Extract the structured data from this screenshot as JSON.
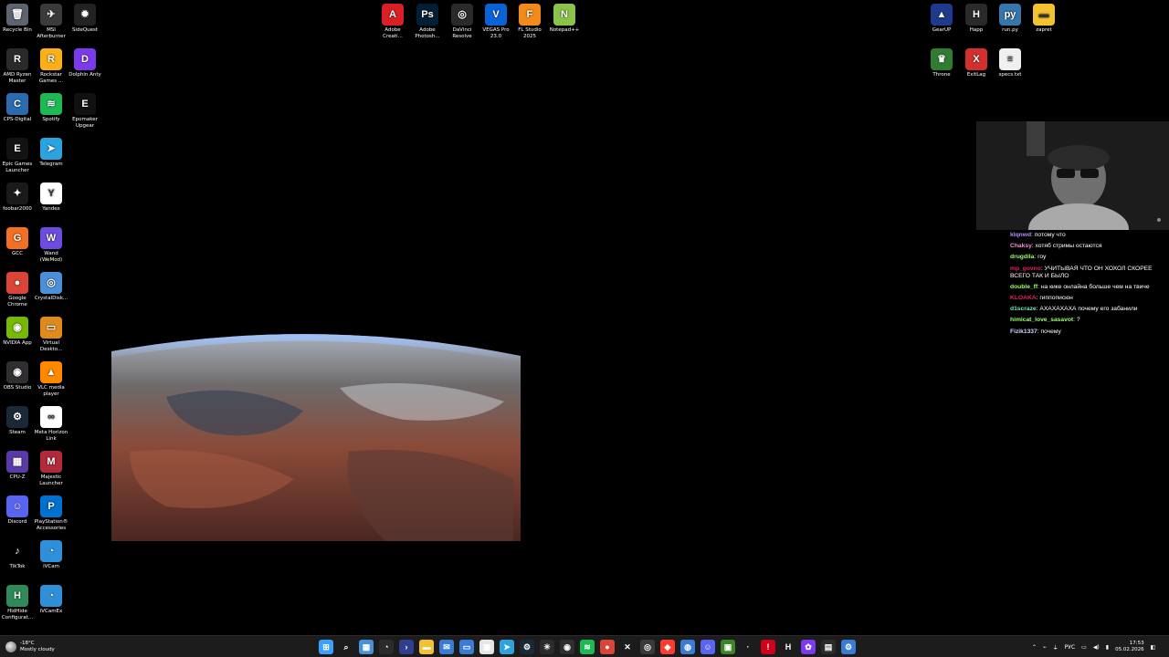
{
  "desktop_icons": [
    {
      "label": "Recycle Bin",
      "icon": "recycle-bin-icon",
      "color": "#5b6470"
    },
    {
      "label": "MSI Afterburner",
      "icon": "msi-afterburner-icon",
      "color": "#3a3a3a"
    },
    {
      "label": "SideQuest",
      "icon": "sidequest-icon",
      "color": "#222222"
    },
    {
      "label": "AMD Ryzen Master",
      "icon": "amd-ryzen-master-icon",
      "color": "#2a2a2a"
    },
    {
      "label": "Rockstar Games ...",
      "icon": "rockstar-games-icon",
      "color": "#fcaf17"
    },
    {
      "label": "Dolphin Anty",
      "icon": "dolphin-anty-icon",
      "color": "#7c3aed"
    },
    {
      "label": "CPS-Digital",
      "icon": "cps-digital-icon",
      "color": "#2b6cb0"
    },
    {
      "label": "Spotify",
      "icon": "spotify-icon",
      "color": "#1db954"
    },
    {
      "label": "Epomaker Upgear",
      "icon": "epomaker-icon",
      "color": "#111111"
    },
    {
      "label": "Epic Games Launcher",
      "icon": "epic-games-icon",
      "color": "#121212"
    },
    {
      "label": "Telegram",
      "icon": "telegram-icon",
      "color": "#2aa3df"
    },
    {
      "label": "foobar2000",
      "icon": "foobar2000-icon",
      "color": "#1a1a1a"
    },
    {
      "label": "Yandex",
      "icon": "yandex-icon",
      "color": "#ffffff"
    },
    {
      "label": "GCC",
      "icon": "gcc-icon",
      "color": "#f36f21"
    },
    {
      "label": "Wand (WeMod)",
      "icon": "wand-icon",
      "color": "#6f4ce0"
    },
    {
      "label": "Google Chrome",
      "icon": "chrome-icon",
      "color": "#db4437"
    },
    {
      "label": "CrystalDisk...",
      "icon": "crystaldisk-icon",
      "color": "#4a90d9"
    },
    {
      "label": "NVIDIA App",
      "icon": "nvidia-icon",
      "color": "#76b900"
    },
    {
      "label": "Virtual Deskto...",
      "icon": "virtual-desktop-icon",
      "color": "#e08a1e"
    },
    {
      "label": "OBS Studio",
      "icon": "obs-icon",
      "color": "#302e31"
    },
    {
      "label": "VLC media player",
      "icon": "vlc-icon",
      "color": "#ff8800"
    },
    {
      "label": "Steam",
      "icon": "steam-icon",
      "color": "#1b2838"
    },
    {
      "label": "Meta Horizon Link",
      "icon": "meta-icon",
      "color": "#ffffff"
    },
    {
      "label": "CPU-Z",
      "icon": "cpu-z-icon",
      "color": "#5a3aa8"
    },
    {
      "label": "Majestic Launcher",
      "icon": "majestic-icon",
      "color": "#b02a3a"
    },
    {
      "label": "Discord",
      "icon": "discord-icon",
      "color": "#5865f2"
    },
    {
      "label": "PlayStation® Accessories",
      "icon": "playstation-icon",
      "color": "#0070d1"
    },
    {
      "label": "TikTok",
      "icon": "tiktok-icon",
      "color": "#000000"
    },
    {
      "label": "iVCam",
      "icon": "ivcam-icon",
      "color": "#2f8fd8"
    },
    {
      "label": "HidHide Configurat...",
      "icon": "hidhide-icon",
      "color": "#2e8b57"
    },
    {
      "label": "iVCamEx",
      "icon": "ivcamex-icon",
      "color": "#2f8fd8"
    },
    {
      "label": "Adobe Creati...",
      "icon": "adobe-cc-icon",
      "color": "#da1f26"
    },
    {
      "label": "Adobe Photosh...",
      "icon": "photoshop-icon",
      "color": "#001e36"
    },
    {
      "label": "DaVinci Resolve",
      "icon": "davinci-icon",
      "color": "#2a2a2a"
    },
    {
      "label": "VEGAS Pro 23.0",
      "icon": "vegas-icon",
      "color": "#0a63d6"
    },
    {
      "label": "FL Studio 2025",
      "icon": "fl-studio-icon",
      "color": "#f28b1b"
    },
    {
      "label": "Notepad++",
      "icon": "notepadpp-icon",
      "color": "#8bc34a"
    },
    {
      "label": "GearUP",
      "icon": "gearup-icon",
      "color": "#1e3a8a"
    },
    {
      "label": "Happ",
      "icon": "happ-icon",
      "color": "#2a2a2a"
    },
    {
      "label": "run.py",
      "icon": "python-file-icon",
      "color": "#3776ab"
    },
    {
      "label": "zapret",
      "icon": "folder-icon",
      "color": "#f3c230"
    },
    {
      "label": "Throne",
      "icon": "throne-icon",
      "color": "#2e7d32"
    },
    {
      "label": "ExitLag",
      "icon": "exitlag-icon",
      "color": "#d32f2f"
    },
    {
      "label": "specs.txt",
      "icon": "text-file-icon",
      "color": "#f0f0f0"
    }
  ],
  "chat": {
    "messages": [
      {
        "nick": "klqnwd",
        "nick_color": "#b58cff",
        "text": "потому что"
      },
      {
        "nick": "Chaksy",
        "nick_color": "#ff8ad8",
        "text": "хотяб стримы остаются"
      },
      {
        "nick": "drugdila",
        "nick_color": "#9dff6e",
        "text": "гоу"
      },
      {
        "nick": "mp_govno",
        "nick_color": "#e0245e",
        "text": "УЧИТЫВАЯ ЧТО ОН ХОХОЛ СКОРЕЕ ВСЕГО ТАК И БЫЛО"
      },
      {
        "nick": "double_ff",
        "nick_color": "#9dff6e",
        "text": "на кике онлайна больше чем на твиче"
      },
      {
        "nick": "KLOAKA",
        "nick_color": "#e0245e",
        "text": "гиппописюн"
      },
      {
        "nick": "d1scraze",
        "nick_color": "#6ee7b7",
        "text": "АХАХАХАХА почему его забанили"
      },
      {
        "nick": "himicat_love_sasavot",
        "nick_color": "#9dff6e",
        "text": "?"
      },
      {
        "nick": "Fizik1337",
        "nick_color": "#cfd8ff",
        "text": "почему"
      }
    ]
  },
  "taskbar": {
    "weather_temp": "-18°C",
    "weather_desc": "Mostly cloudy",
    "pinned": [
      {
        "icon": "start-icon",
        "color": "#3aa0ff",
        "glyph": "⊞"
      },
      {
        "icon": "search-icon",
        "color": "#1c1c1c",
        "glyph": "⌕"
      },
      {
        "icon": "widgets-icon",
        "color": "#4a90d9",
        "glyph": "▦"
      },
      {
        "icon": "copilot-icon",
        "color": "#2b2b2b",
        "glyph": "◔"
      },
      {
        "icon": "terminal-icon",
        "color": "#2f3e8f",
        "glyph": "›"
      },
      {
        "icon": "file-explorer-icon",
        "color": "#f3c230",
        "glyph": "▬"
      },
      {
        "icon": "mail-icon",
        "color": "#3a7bd5",
        "glyph": "✉"
      },
      {
        "icon": "photos-icon",
        "color": "#3a7bd5",
        "glyph": "▭"
      },
      {
        "icon": "store-icon",
        "color": "#e5e5e5",
        "glyph": "▣"
      },
      {
        "icon": "telegram-icon",
        "color": "#2aa3df",
        "glyph": "➤"
      },
      {
        "icon": "steam-icon",
        "color": "#1b2838",
        "glyph": "⚙"
      },
      {
        "icon": "chatgpt-icon",
        "color": "#2b2b2b",
        "glyph": "✳"
      },
      {
        "icon": "obs-icon",
        "color": "#302e31",
        "glyph": "◉"
      },
      {
        "icon": "spotify-icon",
        "color": "#1db954",
        "glyph": "≋"
      },
      {
        "icon": "chrome-icon",
        "color": "#db4437",
        "glyph": "●"
      },
      {
        "icon": "capcut-icon",
        "color": "#1c1c1c",
        "glyph": "✕"
      },
      {
        "icon": "davinci-icon",
        "color": "#3a3a3a",
        "glyph": "◎"
      },
      {
        "icon": "yandex-browser-icon",
        "color": "#ff3b30",
        "glyph": "◆"
      },
      {
        "icon": "vpn-icon",
        "color": "#3a7bd5",
        "glyph": "◍"
      },
      {
        "icon": "discord-icon",
        "color": "#5865f2",
        "glyph": "☺"
      },
      {
        "icon": "minecraft-icon",
        "color": "#3c8527",
        "glyph": "▣"
      },
      {
        "icon": "app-icon",
        "color": "#1c1c1c",
        "glyph": "·"
      },
      {
        "icon": "alert-icon",
        "color": "#d0021b",
        "glyph": "!"
      },
      {
        "icon": "happ-icon",
        "color": "#1c1c1c",
        "glyph": "H"
      },
      {
        "icon": "ai-app-icon",
        "color": "#7c3aed",
        "glyph": "✿"
      },
      {
        "icon": "display-app-icon",
        "color": "#2b2b2b",
        "glyph": "▤"
      },
      {
        "icon": "settings-app-icon",
        "color": "#3a7bd5",
        "glyph": "⚙"
      }
    ],
    "lang": "РУС",
    "time": "17:53",
    "date": "05.02.2026"
  }
}
